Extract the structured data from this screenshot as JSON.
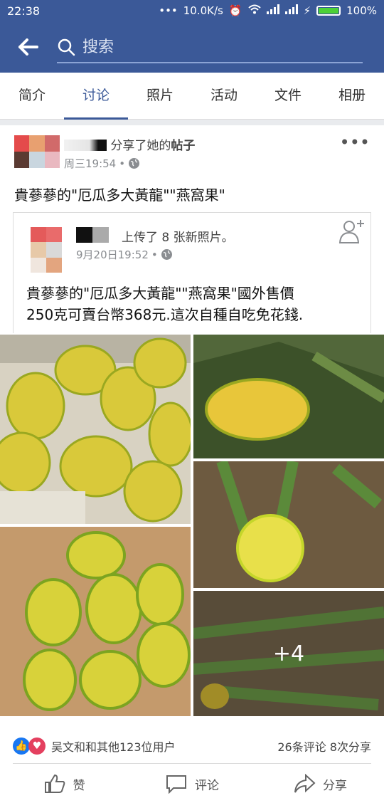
{
  "status_bar": {
    "time": "22:38",
    "speed": "10.0K/s",
    "battery": "100%"
  },
  "search": {
    "placeholder": "搜索"
  },
  "tabs": [
    {
      "label": "简介"
    },
    {
      "label": "讨论"
    },
    {
      "label": "照片"
    },
    {
      "label": "活动"
    },
    {
      "label": "文件"
    },
    {
      "label": "相册"
    }
  ],
  "post": {
    "shared_text": "分享了她的",
    "shared_link": "帖子",
    "time": "周三19:54",
    "text": "貴蔘蔘的\"厄瓜多大黃龍\"\"燕窩果\"",
    "original": {
      "action": "上传了 8 张新照片。",
      "time": "9月20日19:52",
      "desc_line1": "貴蔘蔘的\"厄瓜多大黃龍\"\"燕窩果\"國外售價",
      "desc_line2": "250克可賣台幣368元.這次自種自吃免花錢."
    },
    "photos_more": "+4",
    "reactions_text": "吴文和和其他123位用户",
    "counts": "26条评论  8次分享"
  },
  "actions": {
    "like": "赞",
    "comment": "评论",
    "share": "分享"
  },
  "colors": {
    "brand": "#3b5998",
    "like_blue": "#1877f2",
    "love_red": "#e4405f"
  }
}
